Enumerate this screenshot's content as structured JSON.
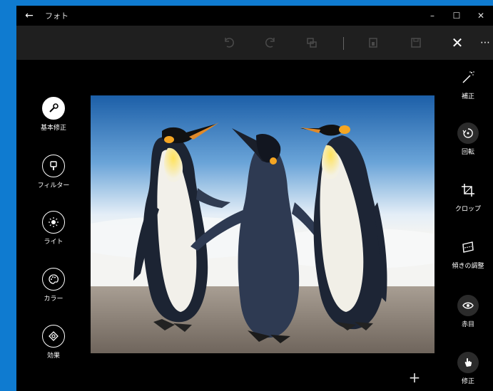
{
  "window": {
    "title": "フォト",
    "back_glyph": "←"
  },
  "window_controls": {
    "minimize": "–",
    "maximize": "☐",
    "close": "✕"
  },
  "toolbar": {
    "close_glyph": "✕",
    "more_glyph": "⋯"
  },
  "left_tools": [
    {
      "label": "基本修正",
      "icon": "wrench-icon",
      "active": true
    },
    {
      "label": "フィルター",
      "icon": "filter-icon",
      "active": false
    },
    {
      "label": "ライト",
      "icon": "light-icon",
      "active": false
    },
    {
      "label": "カラー",
      "icon": "palette-icon",
      "active": false
    },
    {
      "label": "効果",
      "icon": "effects-icon",
      "active": false
    }
  ],
  "right_tools": [
    {
      "label": "補正",
      "icon": "magic-wand-icon"
    },
    {
      "label": "回転",
      "icon": "rotate-icon"
    },
    {
      "label": "クロップ",
      "icon": "crop-icon"
    },
    {
      "label": "傾きの調整",
      "icon": "straighten-icon"
    },
    {
      "label": "赤目",
      "icon": "eye-icon"
    },
    {
      "label": "修正",
      "icon": "spot-fix-icon"
    }
  ],
  "add_glyph": "+",
  "colors": {
    "accent": "#0f7bd0",
    "toolbar": "#1f1f1f",
    "canvas": "#000000"
  }
}
